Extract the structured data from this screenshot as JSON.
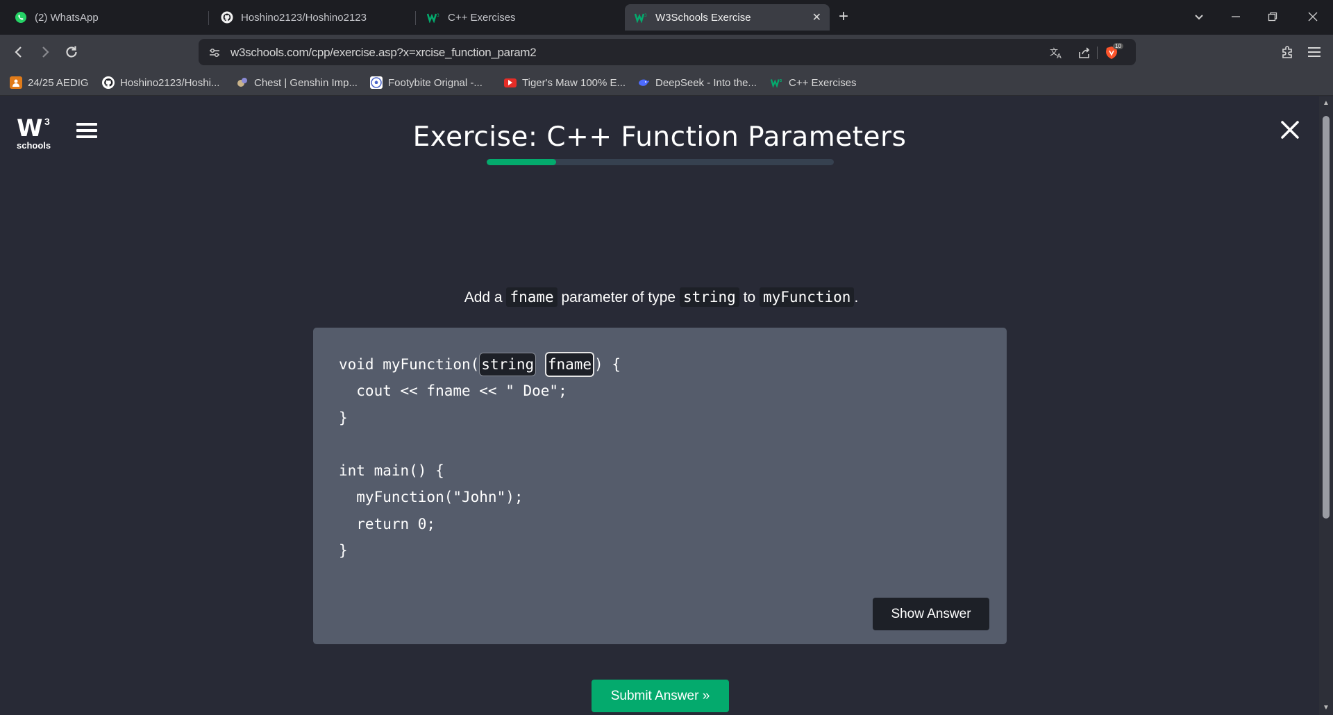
{
  "browser": {
    "tabs": [
      {
        "label": "(2) WhatsApp",
        "icon": "whatsapp-icon"
      },
      {
        "label": "Hoshino2123/Hoshino2123",
        "icon": "github-icon"
      },
      {
        "label": "C++ Exercises",
        "icon": "w3schools-icon"
      },
      {
        "label": "W3Schools Exercise",
        "icon": "w3schools-icon",
        "active": true
      }
    ],
    "tab_close": "✕",
    "new_tab": "+",
    "url": "w3schools.com/cpp/exercise.asp?x=xrcise_function_param2",
    "extension_badge": "10",
    "bookmarks": [
      {
        "label": "24/25 AEDIG",
        "color": "#e07b1a"
      },
      {
        "label": "Hoshino2123/Hoshi...",
        "color": "#ffffff"
      },
      {
        "label": "Chest | Genshin Imp...",
        "color": "#8b8bd6"
      },
      {
        "label": "Footybite Orignal -...",
        "color": "#4a63c9"
      },
      {
        "label": "Tiger's Maw 100% E...",
        "color": "#e52d27"
      },
      {
        "label": "DeepSeek - Into the...",
        "color": "#4d6bfe"
      },
      {
        "label": "C++ Exercises",
        "color": "#04aa6d"
      }
    ]
  },
  "page": {
    "logo_main": "W",
    "logo_sup": "3",
    "logo_sub": "schools",
    "title": "Exercise: C++ Function Parameters",
    "progress": 0.2,
    "instruction": {
      "p1": "Add a",
      "c1": "fname",
      "p2": "parameter of type",
      "c2": "string",
      "p3": "to",
      "c3": "myFunction",
      "p4": "."
    },
    "code": {
      "l1a": "void myFunction(",
      "blank1": "string",
      "blank2": "fname",
      "l1b": ") {",
      "l2": "  cout << fname << \" Doe\";",
      "l3": "}",
      "l4": "",
      "l5": "int main() {",
      "l6": "  myFunction(\"John\");",
      "l7": "  return 0;",
      "l8": "}"
    },
    "show_answer": "Show Answer",
    "submit": "Submit Answer »"
  },
  "colors": {
    "accent": "#04aa6d",
    "page_bg": "#282a36",
    "code_panel": "#555c6b"
  }
}
